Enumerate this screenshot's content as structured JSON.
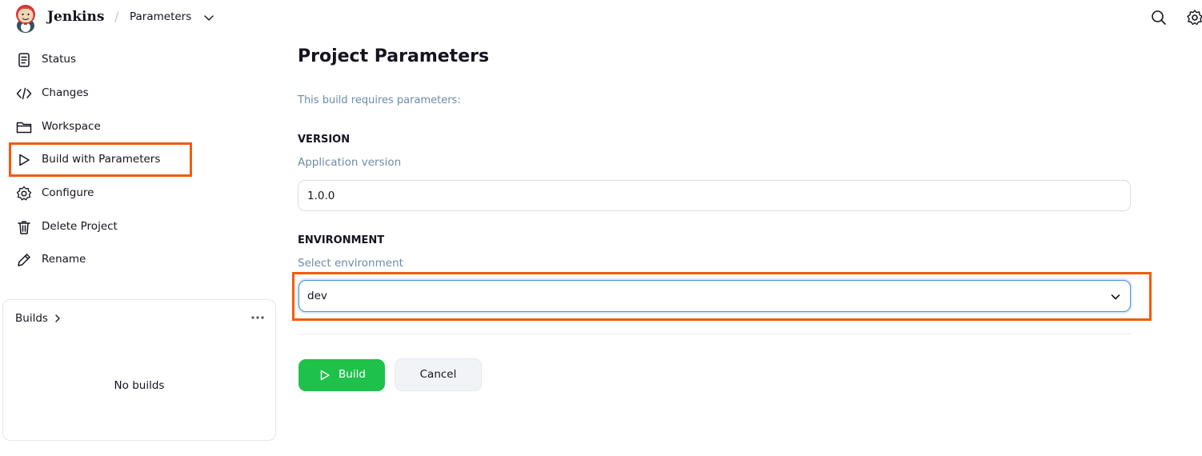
{
  "header": {
    "brand": "Jenkins",
    "separator": "/",
    "breadcrumb": "Parameters"
  },
  "sidebar": {
    "items": [
      {
        "label": "Status",
        "icon": "document-icon"
      },
      {
        "label": "Changes",
        "icon": "code-icon"
      },
      {
        "label": "Workspace",
        "icon": "folder-icon"
      },
      {
        "label": "Build with Parameters",
        "icon": "play-icon"
      },
      {
        "label": "Configure",
        "icon": "gear-icon"
      },
      {
        "label": "Delete Project",
        "icon": "trash-icon"
      },
      {
        "label": "Rename",
        "icon": "pencil-icon"
      }
    ],
    "builds": {
      "title": "Builds",
      "empty": "No builds"
    }
  },
  "main": {
    "title": "Project Parameters",
    "intro": "This build requires parameters:",
    "params": [
      {
        "name": "VERSION",
        "description": "Application version",
        "value": "1.0.0"
      },
      {
        "name": "ENVIRONMENT",
        "description": "Select environment",
        "value": "dev"
      }
    ],
    "build_label": "Build",
    "cancel_label": "Cancel"
  },
  "colors": {
    "highlight": "#f55a0d",
    "build_button": "#1ec24b",
    "focus": "#4a90d9"
  }
}
